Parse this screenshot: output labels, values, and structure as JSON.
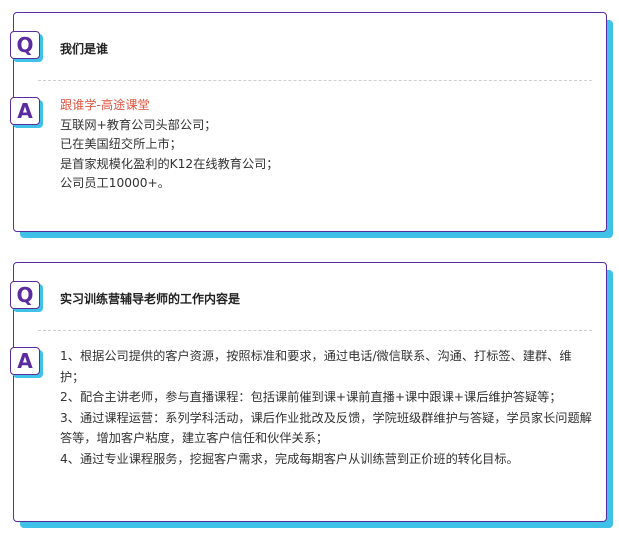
{
  "colors": {
    "accent_border": "#5a2ca0",
    "shadow_cyan": "#3fc1e8",
    "highlight_red": "#e0533f"
  },
  "cards": [
    {
      "question_badge": "Q",
      "question": "我们是谁",
      "answer_badge": "A",
      "answer_lines": [
        "跟谁学-高途课堂",
        "互联网+教育公司头部公司；",
        "已在美国纽交所上市；",
        "是首家规模化盈利的K12在线教育公司；",
        "公司员工10000+。"
      ]
    },
    {
      "question_badge": "Q",
      "question": "实习训练营辅导老师的工作内容是",
      "answer_badge": "A",
      "answer_paragraphs": [
        "1、根据公司提供的客户资源，按照标准和要求，通过电话/微信联系、沟通、打标签、建群、维护；",
        "2、配合主讲老师，参与直播课程：包括课前催到课+课前直播+课中跟课+课后维护答疑等；",
        "3、通过课程运营：系列学科活动，课后作业批改及反馈，学院班级群维护与答疑，学员家长问题解答等，增加客户粘度，建立客户信任和伙伴关系；",
        "4、通过专业课程服务，挖掘客户需求，完成每期客户从训练营到正价班的转化目标。"
      ]
    }
  ]
}
